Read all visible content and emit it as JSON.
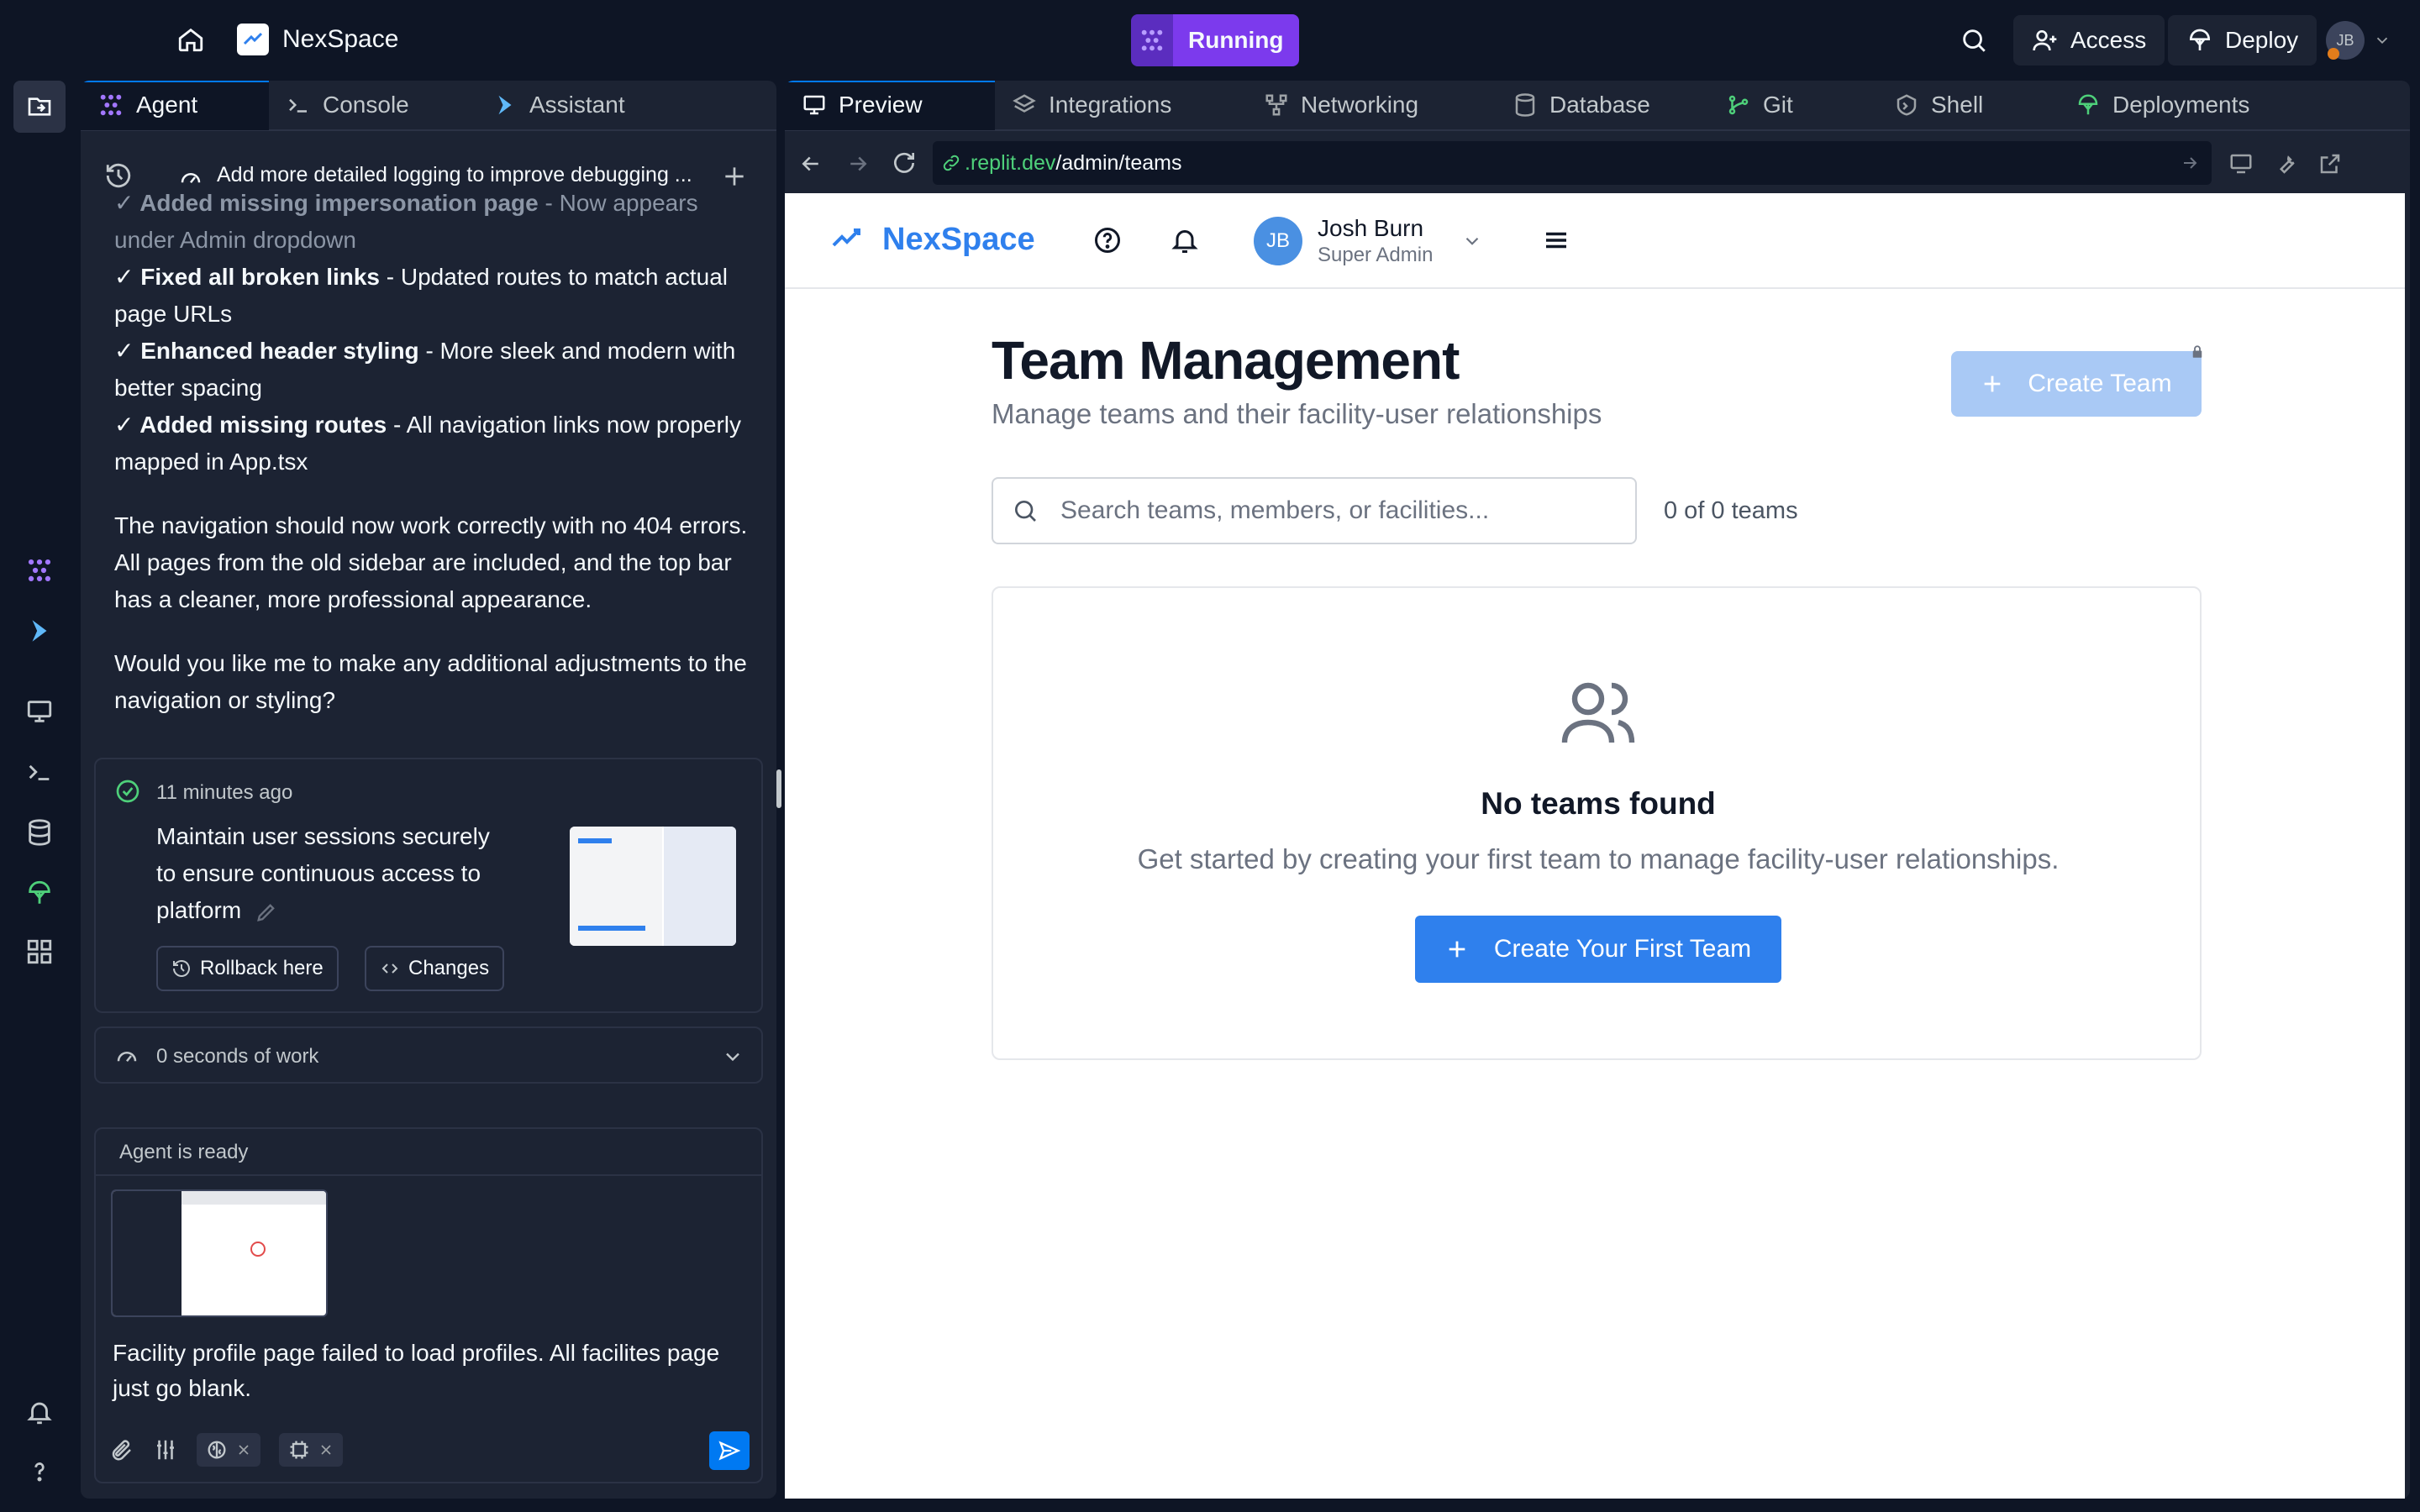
{
  "topbar": {
    "app_name": "NexSpace",
    "status": "Running",
    "access_label": "Access",
    "deploy_label": "Deploy",
    "avatar_initials": "JB"
  },
  "agent": {
    "tabs": [
      {
        "label": "Agent",
        "icon": "agent-icon"
      },
      {
        "label": "Console",
        "icon": "terminal-icon"
      },
      {
        "label": "Assistant",
        "icon": "assistant-icon"
      }
    ],
    "thread_title": "Add more detailed logging to improve debugging ...",
    "messages": [
      {
        "bold": "✓ Added missing impersonation page",
        "rest": " - Now appears under Admin dropdown"
      },
      {
        "bold": "✓ Fixed all broken links",
        "rest": " - Updated routes to match actual page URLs"
      },
      {
        "bold": "✓ Enhanced header styling",
        "rest": " - More sleek and modern with better spacing"
      },
      {
        "bold": "✓ Added missing routes",
        "rest": " - All navigation links now properly mapped in App.tsx"
      }
    ],
    "paragraph1": "The navigation should now work correctly with no 404 errors. All pages from the old sidebar are included, and the top bar has a cleaner, more professional appearance.",
    "paragraph2": "Would you like me to make any additional adjustments to the navigation or styling?",
    "checkpoint": {
      "time": "11 minutes ago",
      "text": "Maintain user sessions securely to ensure continuous access to platform",
      "rollback_label": "Rollback here",
      "changes_label": "Changes"
    },
    "work_label": "0 seconds of work",
    "status_label": "Agent is ready",
    "input_text": "Facility profile page failed to load profiles. All facilites page just go blank."
  },
  "preview": {
    "tabs": [
      {
        "label": "Preview",
        "icon": "monitor-icon"
      },
      {
        "label": "Integrations",
        "icon": "layers-icon"
      },
      {
        "label": "Networking",
        "icon": "network-icon"
      },
      {
        "label": "Database",
        "icon": "database-icon"
      },
      {
        "label": "Git",
        "icon": "git-icon"
      },
      {
        "label": "Shell",
        "icon": "shell-icon"
      },
      {
        "label": "Deployments",
        "icon": "deploy-icon"
      }
    ],
    "url_domain": ".replit.dev",
    "url_path": "/admin/teams"
  },
  "app": {
    "brand": "NexSpace",
    "user_name": "Josh Burn",
    "user_role": "Super Admin",
    "user_initials": "JB",
    "page_title": "Team Management",
    "page_subtitle": "Manage teams and their facility-user relationships",
    "create_team_label": "Create Team",
    "search_placeholder": "Search teams, members, or facilities...",
    "count_text": "0 of 0 teams",
    "empty_title": "No teams found",
    "empty_desc": "Get started by creating your first team to manage facility-user relationships.",
    "create_first_label": "Create Your First Team"
  },
  "colors": {
    "accent": "#0079f2",
    "running": "#7c3aed",
    "app_primary": "#2f80ed"
  }
}
